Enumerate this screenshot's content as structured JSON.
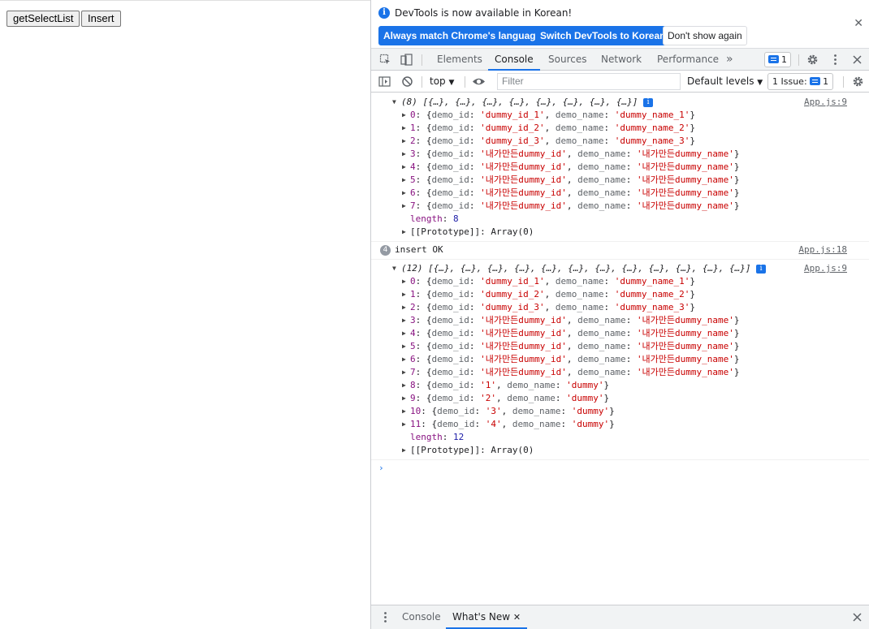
{
  "page": {
    "buttons": [
      "getSelectList",
      "Insert"
    ]
  },
  "devtools": {
    "infobar": {
      "message": "DevTools is now available in Korean!",
      "btn_match": "Always match Chrome's language",
      "btn_switch": "Switch DevTools to Korean",
      "btn_dismiss": "Don't show again"
    },
    "tabs": [
      "Elements",
      "Console",
      "Sources",
      "Network",
      "Performance"
    ],
    "active_tab": "Console",
    "message_count": "1",
    "toolbar": {
      "context": "top",
      "filter_placeholder": "Filter",
      "levels": "Default levels",
      "issues_label": "1 Issue:",
      "issues_count": "1"
    },
    "console": {
      "groups": [
        {
          "summary": "(8) [{…}, {…}, {…}, {…}, {…}, {…}, {…}, {…}]",
          "source": "App.js:9",
          "items": [
            {
              "key": "0",
              "id": "'dummy_id_1'",
              "name": "'dummy_name_1'"
            },
            {
              "key": "1",
              "id": "'dummy_id_2'",
              "name": "'dummy_name_2'"
            },
            {
              "key": "2",
              "id": "'dummy_id_3'",
              "name": "'dummy_name_3'"
            },
            {
              "key": "3",
              "id": "'내가만든dummy_id'",
              "name": "'내가만든dummy_name'"
            },
            {
              "key": "4",
              "id": "'내가만든dummy_id'",
              "name": "'내가만든dummy_name'"
            },
            {
              "key": "5",
              "id": "'내가만든dummy_id'",
              "name": "'내가만든dummy_name'"
            },
            {
              "key": "6",
              "id": "'내가만든dummy_id'",
              "name": "'내가만든dummy_name'"
            },
            {
              "key": "7",
              "id": "'내가만든dummy_id'",
              "name": "'내가만든dummy_name'"
            }
          ],
          "length": "8",
          "prototype": "[[Prototype]]: Array(0)"
        },
        {
          "summary": "(12) [{…}, {…}, {…}, {…}, {…}, {…}, {…}, {…}, {…}, {…}, {…}, {…}]",
          "source": "App.js:9",
          "items": [
            {
              "key": "0",
              "id": "'dummy_id_1'",
              "name": "'dummy_name_1'"
            },
            {
              "key": "1",
              "id": "'dummy_id_2'",
              "name": "'dummy_name_2'"
            },
            {
              "key": "2",
              "id": "'dummy_id_3'",
              "name": "'dummy_name_3'"
            },
            {
              "key": "3",
              "id": "'내가만든dummy_id'",
              "name": "'내가만든dummy_name'"
            },
            {
              "key": "4",
              "id": "'내가만든dummy_id'",
              "name": "'내가만든dummy_name'"
            },
            {
              "key": "5",
              "id": "'내가만든dummy_id'",
              "name": "'내가만든dummy_name'"
            },
            {
              "key": "6",
              "id": "'내가만든dummy_id'",
              "name": "'내가만든dummy_name'"
            },
            {
              "key": "7",
              "id": "'내가만든dummy_id'",
              "name": "'내가만든dummy_name'"
            },
            {
              "key": "8",
              "id": "'1'",
              "name": "'dummy'"
            },
            {
              "key": "9",
              "id": "'2'",
              "name": "'dummy'"
            },
            {
              "key": "10",
              "id": "'3'",
              "name": "'dummy'"
            },
            {
              "key": "11",
              "id": "'4'",
              "name": "'dummy'"
            }
          ],
          "length": "12",
          "prototype": "[[Prototype]]: Array(0)"
        }
      ],
      "insert_log": {
        "count": "4",
        "text": "insert OK",
        "source": "App.js:18"
      }
    },
    "drawer": {
      "tabs": [
        "Console",
        "What's New"
      ],
      "active": "What's New"
    }
  }
}
